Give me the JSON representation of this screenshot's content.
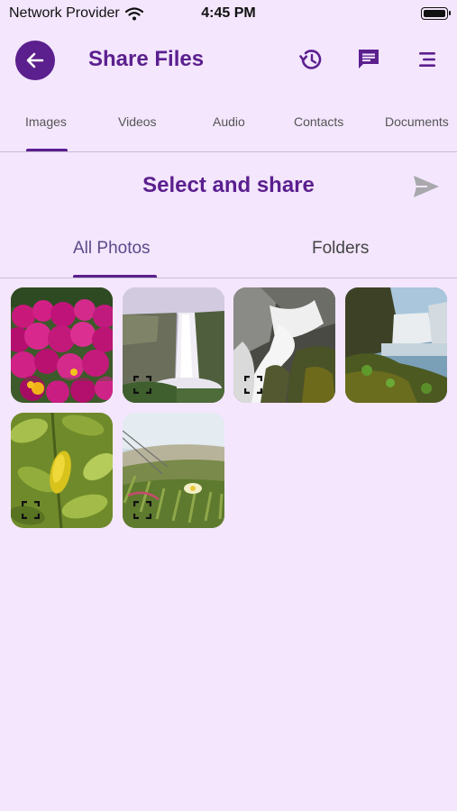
{
  "status_bar": {
    "carrier": "Network Provider",
    "time": "4:45 PM"
  },
  "app_bar": {
    "title": "Share Files"
  },
  "top_tabs": [
    "Images",
    "Videos",
    "Audio",
    "Contacts",
    "Documents"
  ],
  "section_title": "Select and share",
  "sub_tabs": [
    "All Photos",
    "Folders"
  ],
  "photos": [
    {
      "subject": "pink flowers",
      "expand_icon": false
    },
    {
      "subject": "waterfall cliff",
      "expand_icon": true
    },
    {
      "subject": "waterfall rocks",
      "expand_icon": true
    },
    {
      "subject": "waterfall river",
      "expand_icon": false
    },
    {
      "subject": "green leaves",
      "expand_icon": true
    },
    {
      "subject": "coastal plants",
      "expand_icon": true
    }
  ],
  "colors": {
    "background": "#f3e6fd",
    "accent": "#5b1f8e",
    "divider": "#c8bdd2"
  }
}
